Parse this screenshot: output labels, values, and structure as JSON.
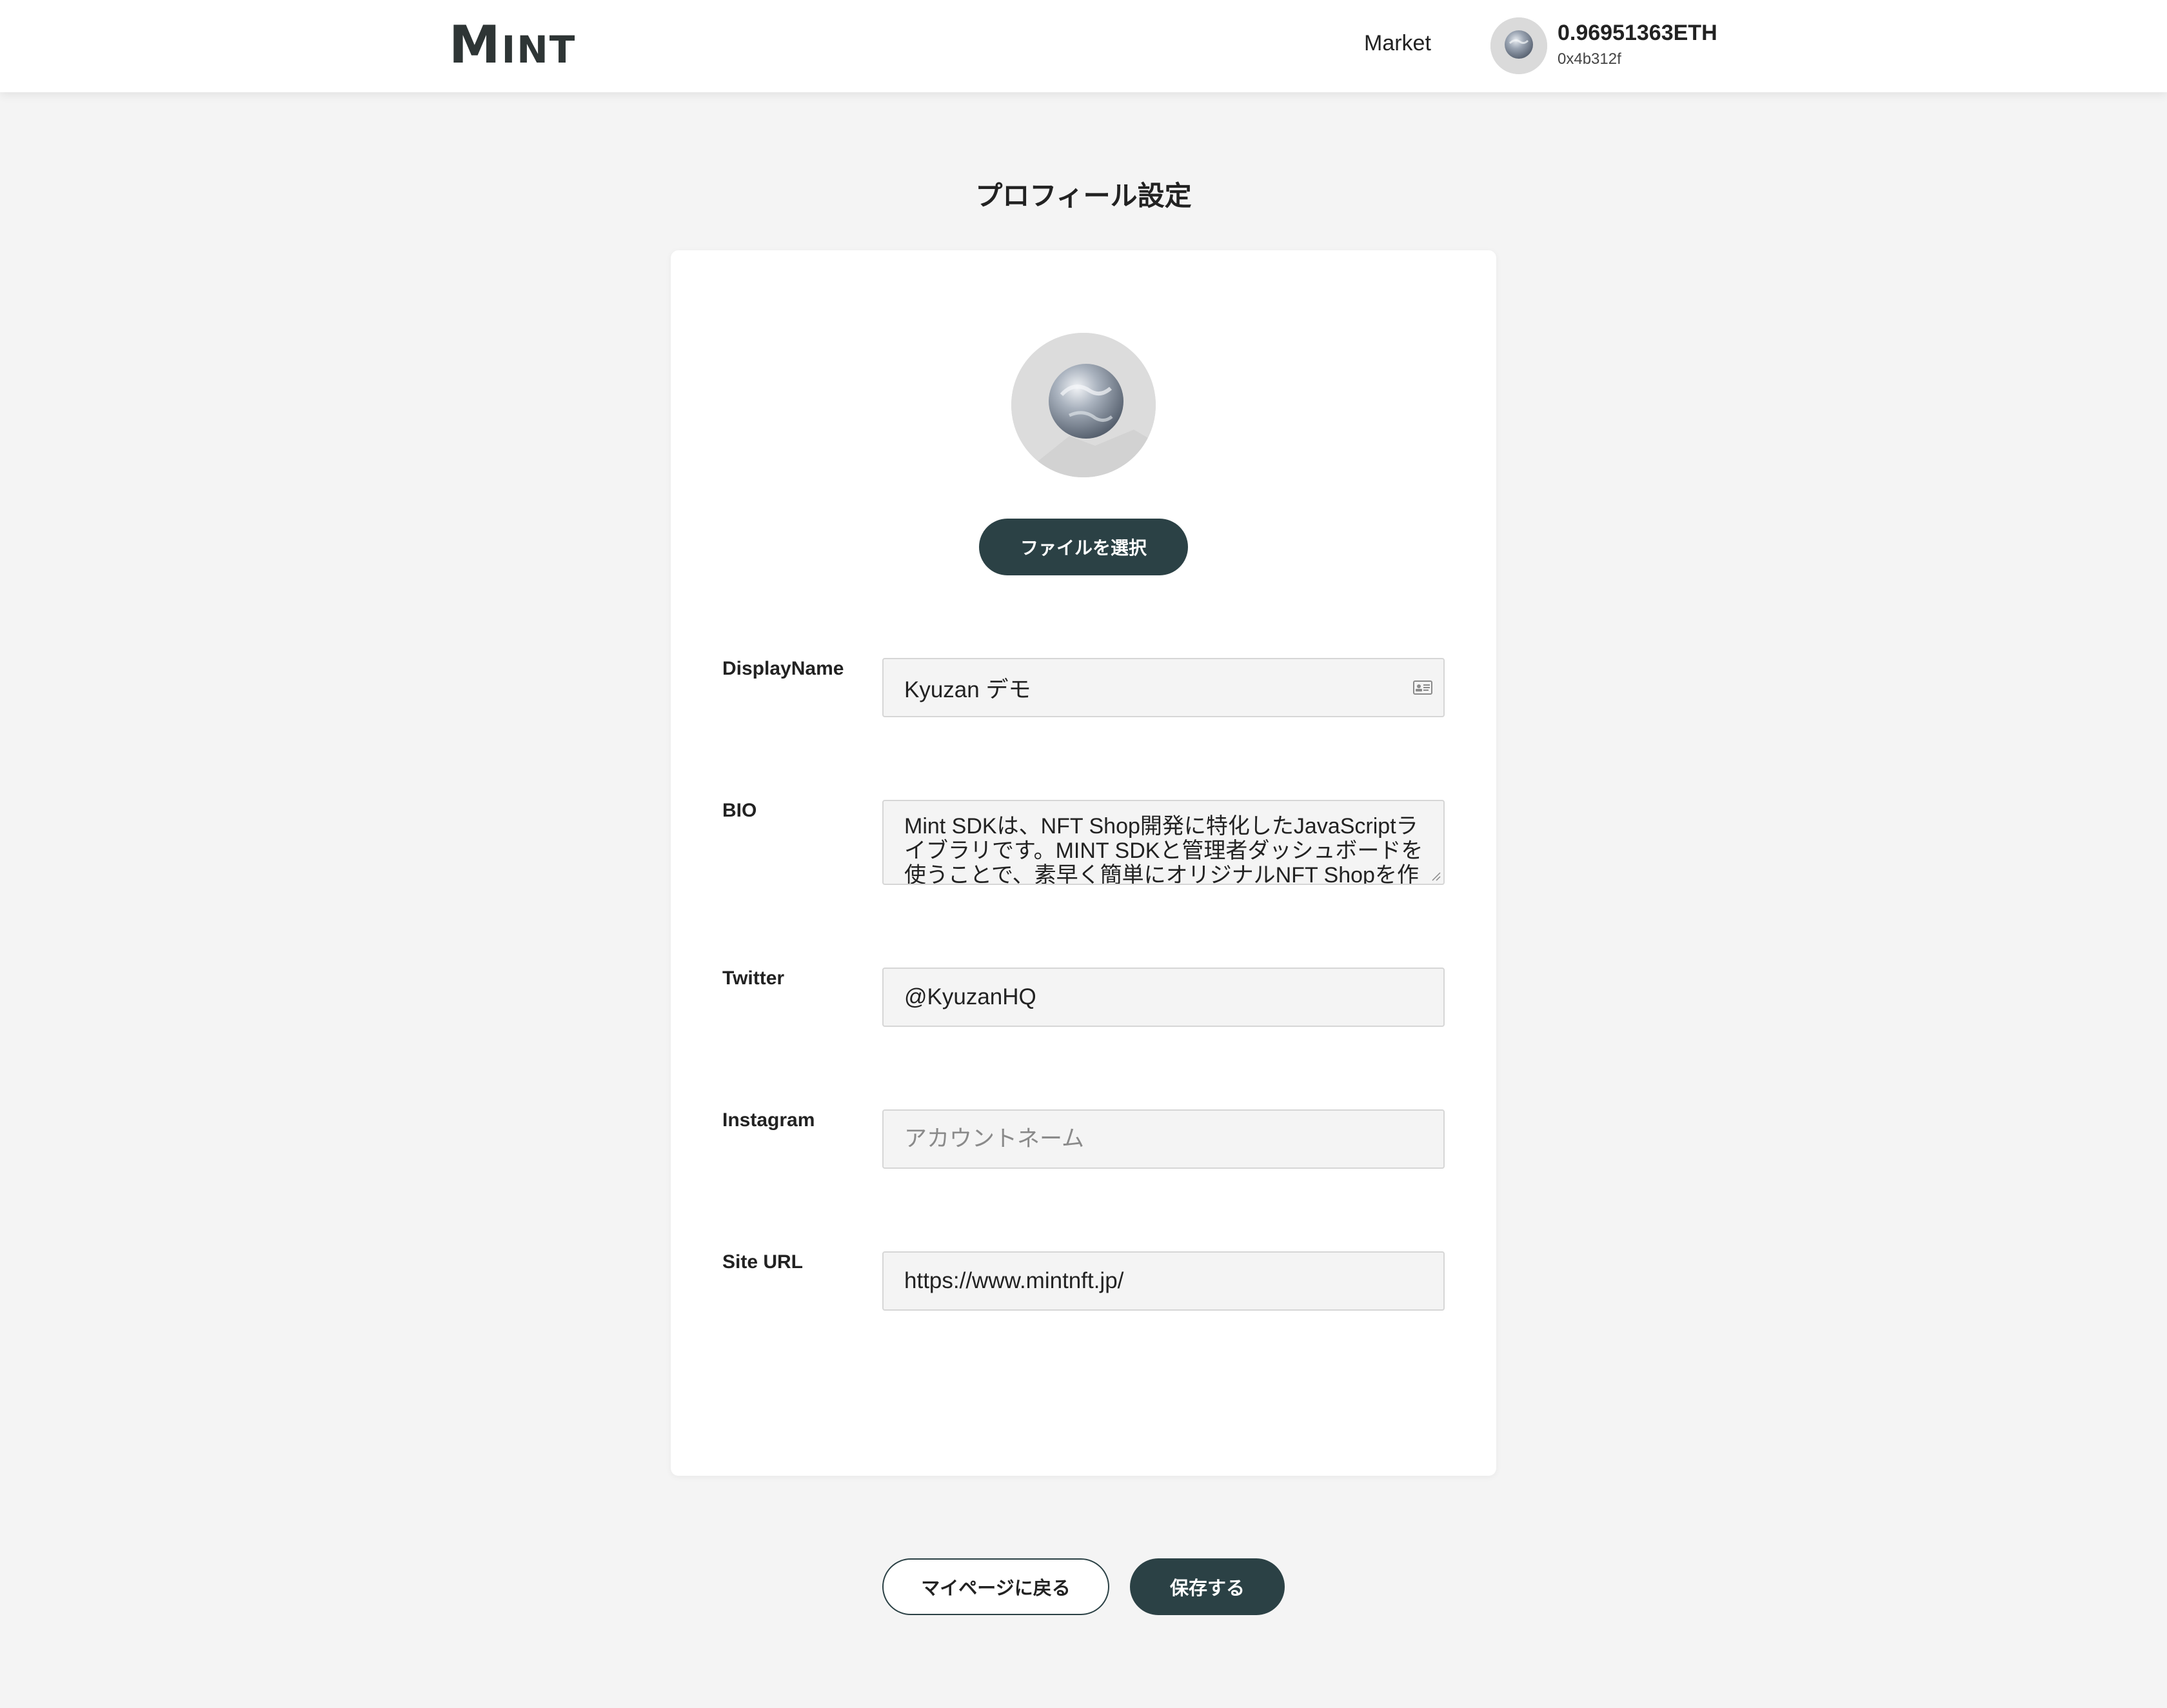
{
  "header": {
    "logo_big": "M",
    "logo_small": "INT",
    "market_label": "Market",
    "balance": "0.96951363ETH",
    "address": "0x4b312f"
  },
  "page": {
    "title": "プロフィール設定"
  },
  "profile": {
    "choose_file_label": "ファイルを選択"
  },
  "fields": {
    "display_name": {
      "label": "DisplayName",
      "value": "Kyuzan デモ"
    },
    "bio": {
      "label": "BIO",
      "value": "Mint SDKは、NFT Shop開発に特化したJavaScriptライブラリです。MINT SDKと管理者ダッシュボードを使うことで、素早く簡単にオリジナルNFT Shopを作成"
    },
    "twitter": {
      "label": "Twitter",
      "value": "@KyuzanHQ"
    },
    "instagram": {
      "label": "Instagram",
      "value": "",
      "placeholder": "アカウントネーム"
    },
    "site_url": {
      "label": "Site URL",
      "value": "https://www.mintnft.jp/"
    }
  },
  "actions": {
    "back_label": "マイページに戻る",
    "save_label": "保存する"
  },
  "colors": {
    "accent": "#2b4145",
    "page_background": "#f4f4f4",
    "input_background": "#f4f4f4"
  },
  "icons": {
    "contact_card": "contact-card-icon",
    "avatar": "globe-avatar-icon"
  }
}
